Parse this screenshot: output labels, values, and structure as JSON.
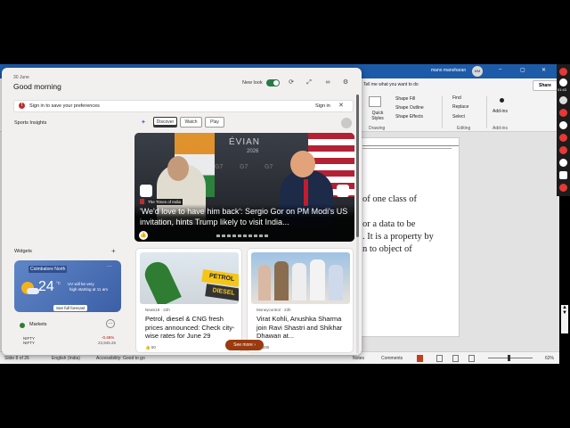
{
  "app": {
    "user_name": "mano manoharan",
    "avatar_initials": "MM",
    "window_controls": [
      "–",
      "▢",
      "✕"
    ],
    "tell_me": "Tell me what you want to do",
    "share": "Share",
    "ribbon": {
      "quick_styles": "Quick Styles",
      "shape_fill": "Shape Fill",
      "shape_outline": "Shape Outline",
      "shape_effects": "Shape Effects",
      "drawing_group": "Drawing",
      "find": "Find",
      "replace": "Replace",
      "select": "Select",
      "editing_group": "Editing",
      "addins": "Add-ins",
      "addins_group": "Add-ins"
    },
    "slide_text": [
      "of one class of",
      "",
      "or a data to be",
      ". It is a property by",
      "n to object of"
    ],
    "status": {
      "slide_info": "Slide 8 of 26",
      "language": "English (India)",
      "accessibility": "Accessibility: Good to go",
      "notes": "Notes",
      "comments": "Comments",
      "zoom": "62%"
    }
  },
  "taskbar_side": {
    "time": "01:43"
  },
  "widgets": {
    "date": "30 June",
    "greeting": "Good morning",
    "new_look": "New look",
    "signin_message": "Sign in to save your preferences",
    "signin": "Sign in",
    "sports_label": "Sports Insights",
    "widgets_label": "Widgets",
    "tabs": [
      "Discover",
      "Watch",
      "Play"
    ],
    "hero": {
      "source": "The Times of India",
      "headline": "'We'd love to have him back': Sergio Gor on PM Modi's US invitation, hints Trump likely to visit India...",
      "bg_text": "ÉVIAN",
      "bg_year": "2026",
      "g7": "G7"
    },
    "weather": {
      "location": "Coimbatore North",
      "temp": "24",
      "unit": "°C",
      "alert_line1": "UV will be very",
      "alert_line2": "high starting at 11 am",
      "forecast": "See full forecast"
    },
    "markets": {
      "title": "Markets",
      "name": "NIFTY",
      "sub": "NIFTY",
      "change": "-0.46%",
      "value": "23,945.25"
    },
    "cards": [
      {
        "source": "News18 · 22h",
        "headline": "Petrol, diesel & CNG fresh prices announced: Check city-wise rates for June 29",
        "reactions": "50",
        "img_text1": "PETROL",
        "img_text2": "DIESEL"
      },
      {
        "source": "Moneycontrol · 23h",
        "headline": "Virat Kohli, Anushka Sharma join Ravi Shastri and Shikhar Dhawan at...",
        "reactions": "285"
      }
    ],
    "see_more": "See more ›"
  }
}
